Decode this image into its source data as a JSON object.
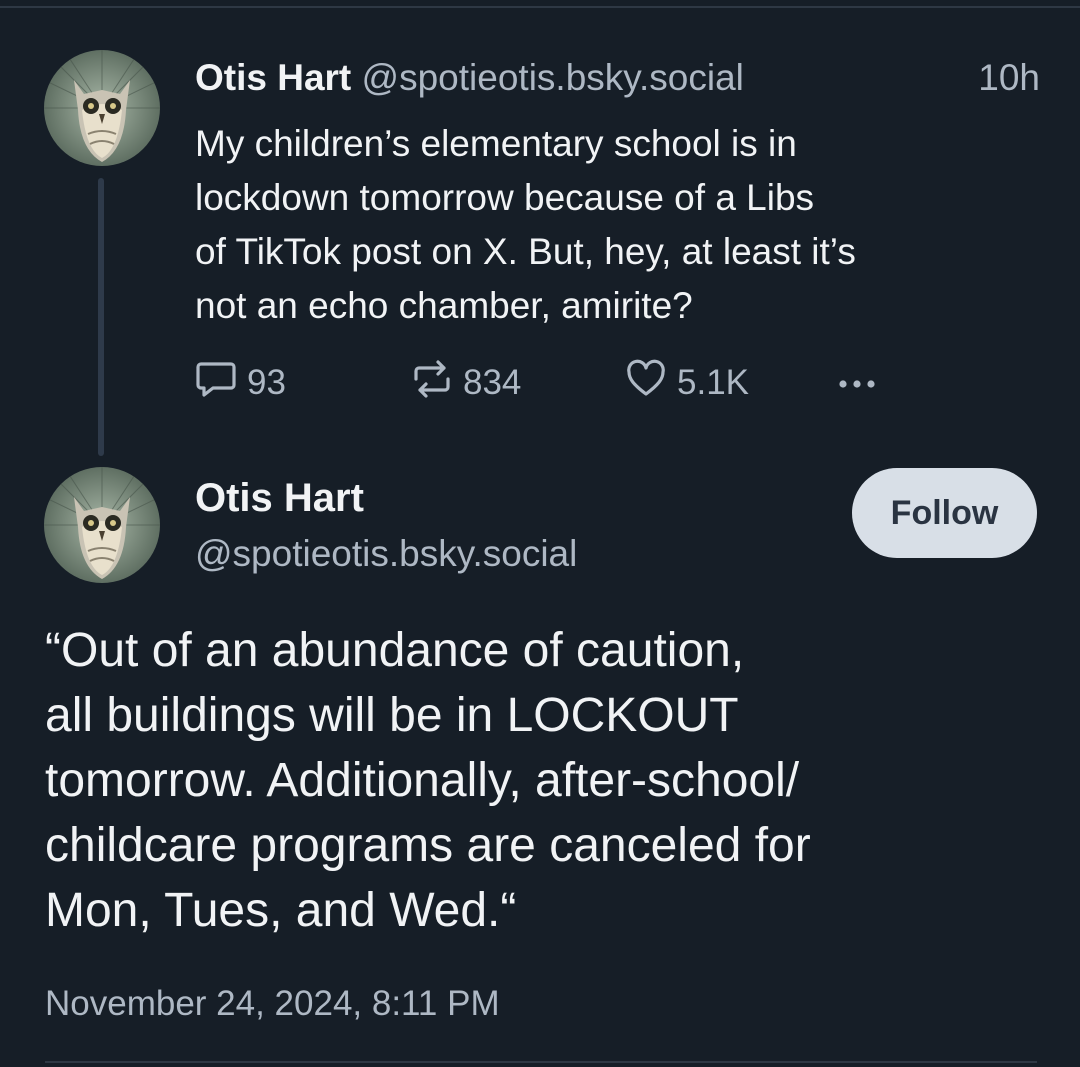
{
  "post1": {
    "display_name": "Otis Hart",
    "handle": "@spotieotis.bsky.social",
    "time": "10h",
    "text": "My children’s elementary school is in\nlockdown tomorrow because of a Libs\nof TikTok post on X. But, hey, at least it’s\nnot an echo chamber, amirite?",
    "actions": {
      "replies": "93",
      "reposts": "834",
      "likes": "5.1K",
      "more_icon": "ellipsis-icon"
    }
  },
  "post2": {
    "display_name": "Otis Hart",
    "handle": "@spotieotis.bsky.social",
    "follow_label": "Follow",
    "text": "“Out of an abundance of caution,\nall buildings will be in LOCKOUT\ntomorrow. Additionally, after-school/\nchildcare programs are canceled for\nMon, Tues, and Wed.“",
    "date": "November 24, 2024, 8:11 PM"
  },
  "colors": {
    "background": "#161e27",
    "text_primary": "#f1f3f5",
    "text_secondary": "#aeb8c4",
    "follow_button_bg": "#d8dfe7",
    "thread_line": "#2e3a4a"
  }
}
